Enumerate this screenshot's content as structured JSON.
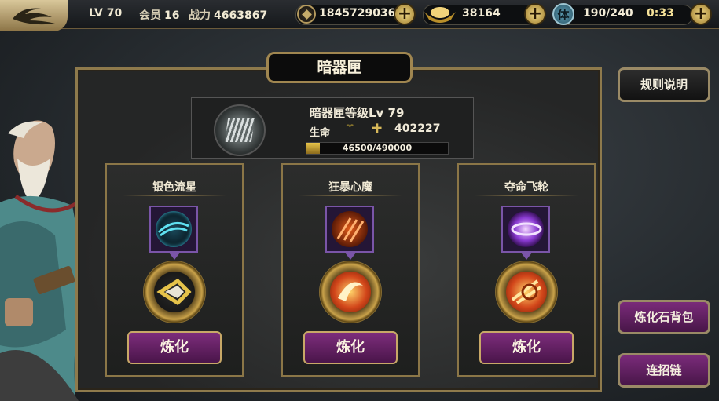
{
  "topbar": {
    "level": "LV 70",
    "vip_label": "会员",
    "vip_value": "16",
    "power_label": "战力",
    "power_value": "4663867",
    "coins": "1845729036",
    "ingots": "38164",
    "stamina_icon_char": "体",
    "stamina": "190/240",
    "timer": "0:33",
    "plus_symbol": "+"
  },
  "panel": {
    "title": "暗器匣",
    "box_level": "暗器匣等级Lv 79",
    "hp_label": "生命",
    "hp_value": "402227",
    "exp_text": "46500/490000",
    "exp_progress": 0.0949
  },
  "cards": [
    {
      "name": "银色流星",
      "button": "炼化"
    },
    {
      "name": "狂暴心魔",
      "button": "炼化"
    },
    {
      "name": "夺命飞轮",
      "button": "炼化"
    }
  ],
  "side": {
    "rules": "规则说明",
    "refine_bag": "炼化石背包",
    "combo": "连招链"
  },
  "icons": {
    "logo": "swirl-logo-icon",
    "coin": "coin-icon",
    "ingot": "gold-ingot-icon",
    "stamina": "stamina-icon",
    "emblem": "hidden-weapon-box-icon",
    "hp": "hp-up-icon"
  }
}
